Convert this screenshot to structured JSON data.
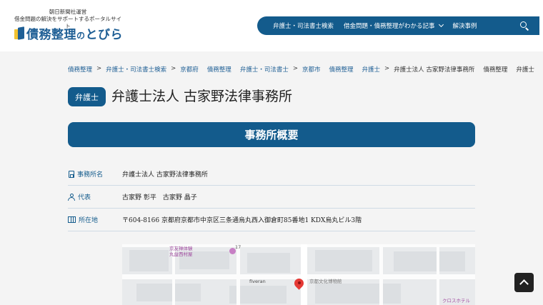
{
  "header": {
    "tagline_line1": "朝日新聞社運営",
    "tagline_line2": "借金問題の解決をサポートするポータルサイト",
    "logo_text_a": "債務整理",
    "logo_text_b": "の",
    "logo_text_c": "とびら",
    "nav": [
      {
        "label": "弁護士・司法書士検索"
      },
      {
        "label": "借金問題・債務整理がわかる記事"
      },
      {
        "label": "解決事例"
      }
    ]
  },
  "breadcrumb": [
    "債務整理",
    "弁護士・司法書士検索",
    "京都府",
    "債務整理",
    "弁護士・司法書士",
    "京都市",
    "債務整理",
    "弁護士",
    "弁護士法人 古家野法律事務所",
    "債務整理",
    "弁護士"
  ],
  "office": {
    "badge": "弁護士",
    "title": "弁護士法人 古家野法律事務所"
  },
  "section_title": "事務所概要",
  "info": [
    {
      "label": "事務所名",
      "value": "弁護士法人 古家野法律事務所",
      "icon": "building-icon"
    },
    {
      "label": "代表",
      "value": "古家野 彰平　古家野 晶子",
      "icon": "person-icon"
    },
    {
      "label": "所在地",
      "value": "〒604-8166 京都府京都市中京区三条通烏丸西入御倉町85番地1 KDX烏丸ビル3階",
      "icon": "map-icon"
    }
  ],
  "map": {
    "labels": {
      "a": "京友禅体験",
      "b": "丸益西村屋",
      "c": "fiveran",
      "d": "京都文化博物館",
      "e": "クロスホテル",
      "route": "17"
    }
  }
}
